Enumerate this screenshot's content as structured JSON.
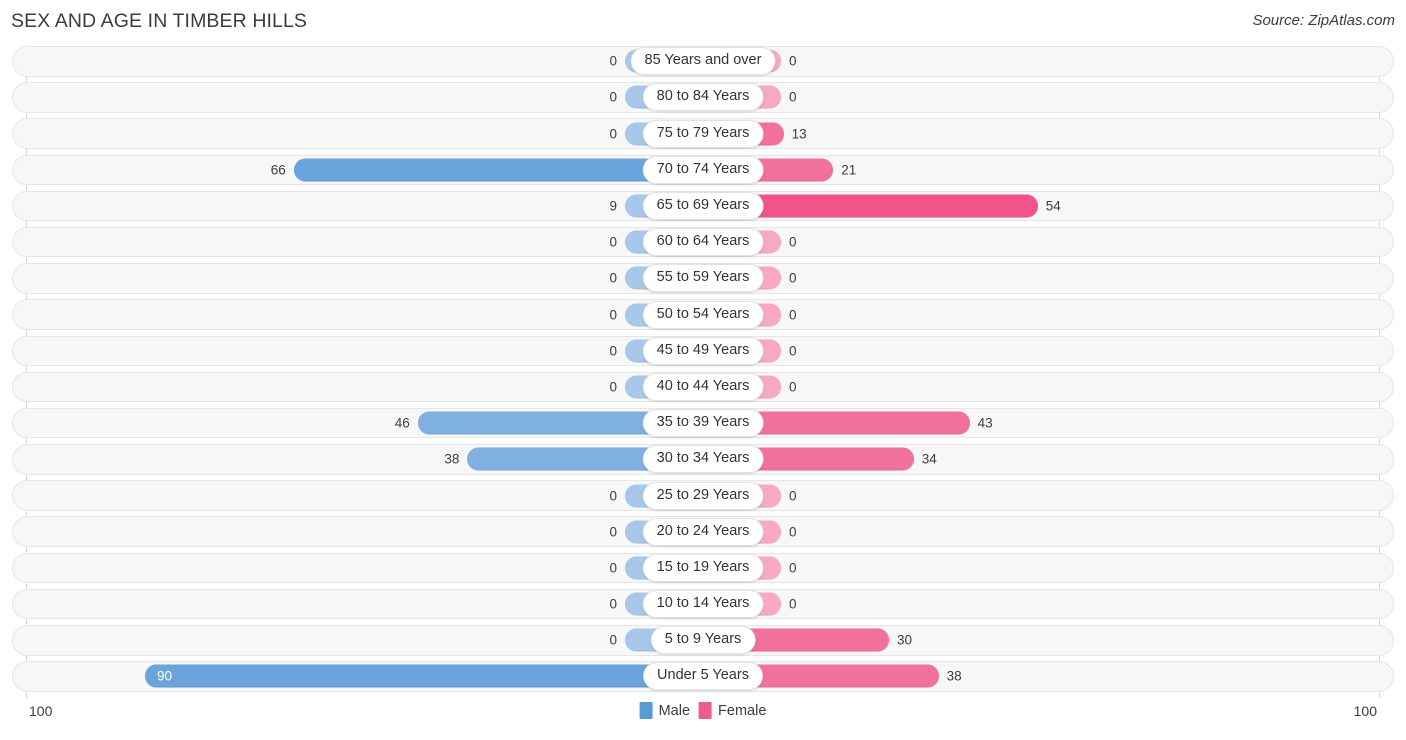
{
  "header": {
    "title": "SEX AND AGE IN TIMBER HILLS",
    "source": "Source: ZipAtlas.com"
  },
  "legend": {
    "male_label": "Male",
    "female_label": "Female",
    "male_color": "#5B9BD5",
    "female_color": "#ED5C8B"
  },
  "axis": {
    "left_tick": "100",
    "right_tick": "100",
    "max": 100
  },
  "colors": {
    "male_light": "#A8C8EA",
    "male_mid": "#7FB0E0",
    "male_strong": "#6BA3DC",
    "female_light": "#F7A8C4",
    "female_mid": "#F2719A",
    "female_strong": "#F0548A",
    "row_background": "#F7F7F7",
    "row_border": "#E6E6E6"
  },
  "chart_data": {
    "type": "bar",
    "title": "SEX AND AGE IN TIMBER HILLS",
    "xlabel": "",
    "ylabel": "",
    "orientation": "horizontal-diverging",
    "xlim": [
      0,
      100
    ],
    "grid": false,
    "legend_position": "bottom-center",
    "categories": [
      "85 Years and over",
      "80 to 84 Years",
      "75 to 79 Years",
      "70 to 74 Years",
      "65 to 69 Years",
      "60 to 64 Years",
      "55 to 59 Years",
      "50 to 54 Years",
      "45 to 49 Years",
      "40 to 44 Years",
      "35 to 39 Years",
      "30 to 34 Years",
      "25 to 29 Years",
      "20 to 24 Years",
      "15 to 19 Years",
      "10 to 14 Years",
      "5 to 9 Years",
      "Under 5 Years"
    ],
    "series": [
      {
        "name": "Male",
        "values": [
          0,
          0,
          0,
          66,
          9,
          0,
          0,
          0,
          0,
          0,
          46,
          38,
          0,
          0,
          0,
          0,
          0,
          90
        ]
      },
      {
        "name": "Female",
        "values": [
          0,
          0,
          13,
          21,
          54,
          0,
          0,
          0,
          0,
          0,
          43,
          34,
          0,
          0,
          0,
          0,
          30,
          38
        ]
      }
    ]
  },
  "rows": [
    {
      "label": "85 Years and over",
      "male": "0",
      "female": "0"
    },
    {
      "label": "80 to 84 Years",
      "male": "0",
      "female": "0"
    },
    {
      "label": "75 to 79 Years",
      "male": "0",
      "female": "13"
    },
    {
      "label": "70 to 74 Years",
      "male": "66",
      "female": "21"
    },
    {
      "label": "65 to 69 Years",
      "male": "9",
      "female": "54"
    },
    {
      "label": "60 to 64 Years",
      "male": "0",
      "female": "0"
    },
    {
      "label": "55 to 59 Years",
      "male": "0",
      "female": "0"
    },
    {
      "label": "50 to 54 Years",
      "male": "0",
      "female": "0"
    },
    {
      "label": "45 to 49 Years",
      "male": "0",
      "female": "0"
    },
    {
      "label": "40 to 44 Years",
      "male": "0",
      "female": "0"
    },
    {
      "label": "35 to 39 Years",
      "male": "46",
      "female": "43"
    },
    {
      "label": "30 to 34 Years",
      "male": "38",
      "female": "34"
    },
    {
      "label": "25 to 29 Years",
      "male": "0",
      "female": "0"
    },
    {
      "label": "20 to 24 Years",
      "male": "0",
      "female": "0"
    },
    {
      "label": "15 to 19 Years",
      "male": "0",
      "female": "0"
    },
    {
      "label": "10 to 14 Years",
      "male": "0",
      "female": "0"
    },
    {
      "label": "5 to 9 Years",
      "male": "0",
      "female": "30"
    },
    {
      "label": "Under 5 Years",
      "male": "90",
      "female": "38"
    }
  ]
}
